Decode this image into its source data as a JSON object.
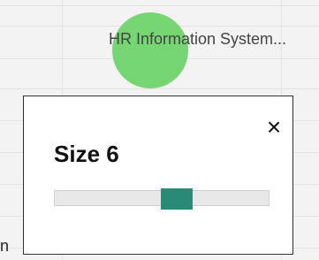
{
  "sheet": {
    "cell_text": "HR Information System...",
    "stray_char": "n"
  },
  "dialog": {
    "title": "Size 6",
    "close_icon": "×",
    "slider": {
      "value": 6,
      "min": 0,
      "max": 12
    }
  },
  "colors": {
    "accent": "#2a8a78",
    "cursor_highlight": "#6fd46b"
  }
}
